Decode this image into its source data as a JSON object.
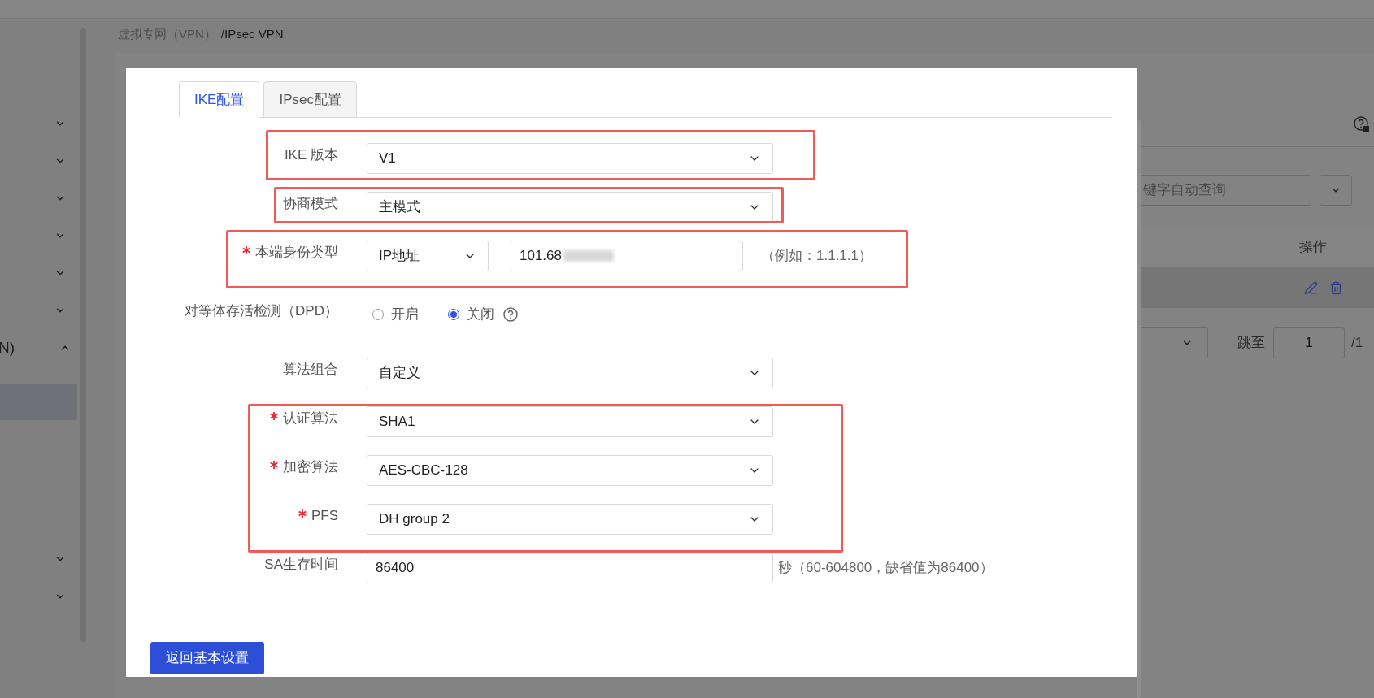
{
  "sidebar": {
    "items": [
      {
        "expanded": false
      },
      {
        "expanded": false
      },
      {
        "expanded": false
      },
      {
        "expanded": false
      },
      {
        "expanded": false
      },
      {
        "expanded": false
      },
      {
        "label": "N)",
        "expanded": true,
        "children": [
          {
            "selected": true
          }
        ]
      },
      {
        "expanded": false
      },
      {
        "expanded": false
      }
    ]
  },
  "breadcrumb": {
    "items": [
      "虚拟专网（VPN）",
      "IPsec VPN"
    ],
    "separator": "/"
  },
  "background_panel": {
    "search_placeholder": "键字自动查询",
    "table": {
      "columns": [
        "操作"
      ]
    },
    "pagination": {
      "jump_label": "跳至",
      "page_value": "1",
      "page_total": "/1"
    }
  },
  "dialog": {
    "tabs": [
      {
        "label": "IKE配置",
        "selected": true
      },
      {
        "label": "IPsec配置",
        "selected": false
      }
    ],
    "groups": [
      {
        "highlighted": true,
        "rows": [
          {
            "kind": "select",
            "label": "IKE 版本",
            "required": false,
            "value": "V1"
          }
        ]
      },
      {
        "highlighted": true,
        "rows": [
          {
            "kind": "select",
            "label": "协商模式",
            "required": false,
            "value": "主模式"
          }
        ]
      },
      {
        "highlighted": true,
        "rows": [
          {
            "kind": "identity",
            "label": "本端身份类型",
            "required": true,
            "type_value": "IP地址",
            "value": "101.68",
            "hint": "（例如：1.1.1.1）"
          }
        ]
      },
      {
        "highlighted": false,
        "rows": [
          {
            "kind": "radio",
            "label": "对等体存活检测（DPD）",
            "required": false,
            "options": [
              {
                "label": "开启",
                "selected": false
              },
              {
                "label": "关闭",
                "selected": true
              }
            ]
          },
          {
            "kind": "select",
            "label": "算法组合",
            "required": false,
            "value": "自定义"
          }
        ]
      },
      {
        "highlighted": true,
        "rows": [
          {
            "kind": "select",
            "label": "认证算法",
            "required": true,
            "value": "SHA1"
          },
          {
            "kind": "select",
            "label": "加密算法",
            "required": true,
            "value": "AES-CBC-128"
          },
          {
            "kind": "select",
            "label": "PFS",
            "required": true,
            "value": "DH group 2"
          }
        ]
      },
      {
        "highlighted": false,
        "rows": [
          {
            "kind": "text",
            "label": "SA生存时间",
            "required": false,
            "value": "86400",
            "hint": "秒（60-604800，缺省值为86400）"
          }
        ]
      }
    ],
    "back_button": "返回基本设置"
  }
}
